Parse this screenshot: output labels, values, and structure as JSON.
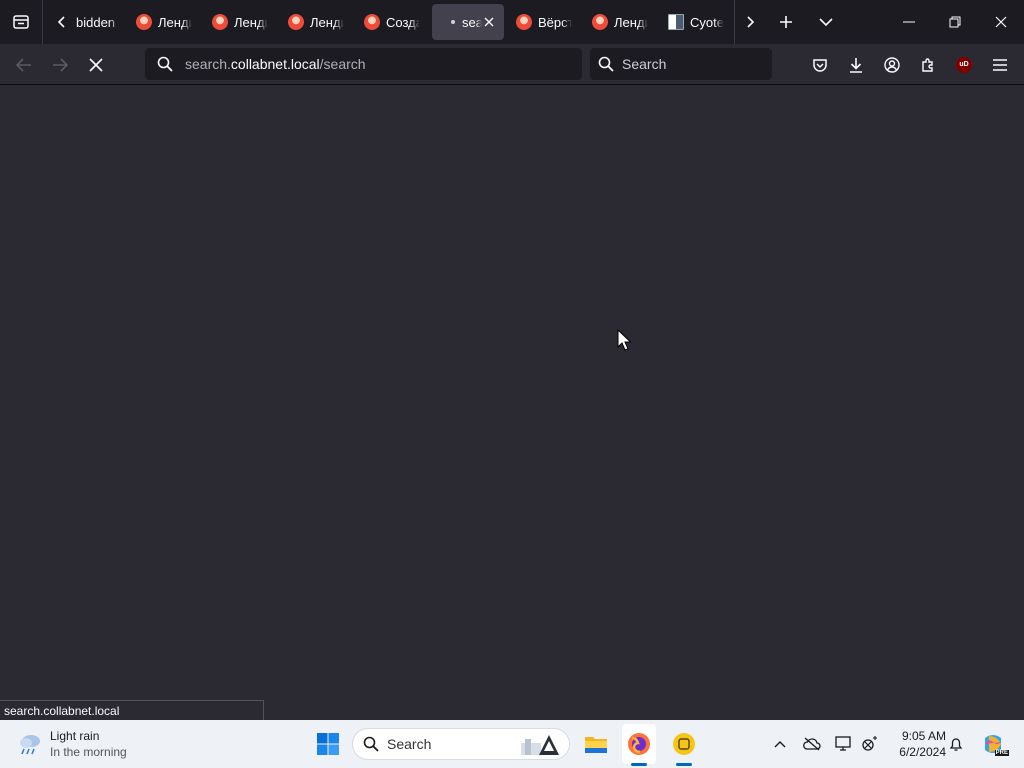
{
  "tabs": [
    {
      "label": "bidden",
      "favicon": "none",
      "active": false
    },
    {
      "label": "Лендинг",
      "favicon": "red-avatar",
      "active": false
    },
    {
      "label": "Лендинг",
      "favicon": "red-avatar",
      "active": false
    },
    {
      "label": "Лендинг",
      "favicon": "red-avatar",
      "active": false
    },
    {
      "label": "Создание",
      "favicon": "red-avatar",
      "active": false
    },
    {
      "label": "search",
      "favicon": "loading-dot",
      "active": true
    },
    {
      "label": "Вёрстка",
      "favicon": "red-avatar",
      "active": false
    },
    {
      "label": "Лендинг",
      "favicon": "red-avatar",
      "active": false
    },
    {
      "label": "Cyote",
      "favicon": "checker",
      "active": false
    }
  ],
  "urlbar": {
    "prefix": "search.",
    "host": "collabnet.local",
    "path": "/search"
  },
  "searchbar": {
    "placeholder": "Search"
  },
  "ublock_label": "uD",
  "status_link": "search.collabnet.local",
  "taskbar": {
    "weather_title": "Light rain",
    "weather_sub": "In the morning",
    "search_placeholder": "Search",
    "time": "9:05 AM",
    "date": "6/2/2024",
    "copilot_badge": "PRE"
  },
  "colors": {
    "tabbar_bg": "#1c1b22",
    "toolbar_bg": "#2b2a33",
    "taskbar_bg": "#eef1f6",
    "accent": "#0067c0"
  }
}
